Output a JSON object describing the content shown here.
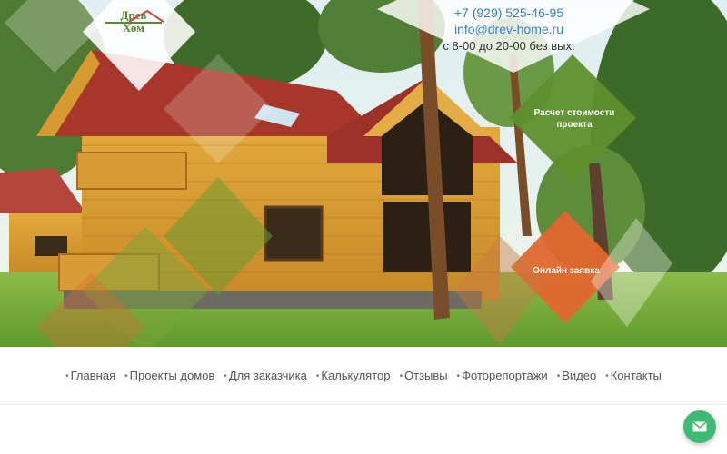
{
  "logo": {
    "line1": "Древ",
    "line2": "Хом"
  },
  "contact": {
    "phone": "+7 (929) 525-46-95",
    "email": "info@drev-home.ru",
    "hours": "с 8-00 до 20-00 без вых."
  },
  "buttons": {
    "calc": "Расчет стоимости проекта",
    "order": "Онлайн заявка"
  },
  "nav": {
    "items": [
      "Главная",
      "Проекты домов",
      "Для заказчика",
      "Калькулятор",
      "Отзывы",
      "Фоторепортажи",
      "Видео",
      "Контакты"
    ]
  },
  "colors": {
    "accent_green": "#6a9a32",
    "accent_orange": "#e0672e",
    "link_blue": "#3b7fc4",
    "chat_green": "#3dbb72"
  },
  "icons": {
    "chat": "envelope-icon"
  }
}
